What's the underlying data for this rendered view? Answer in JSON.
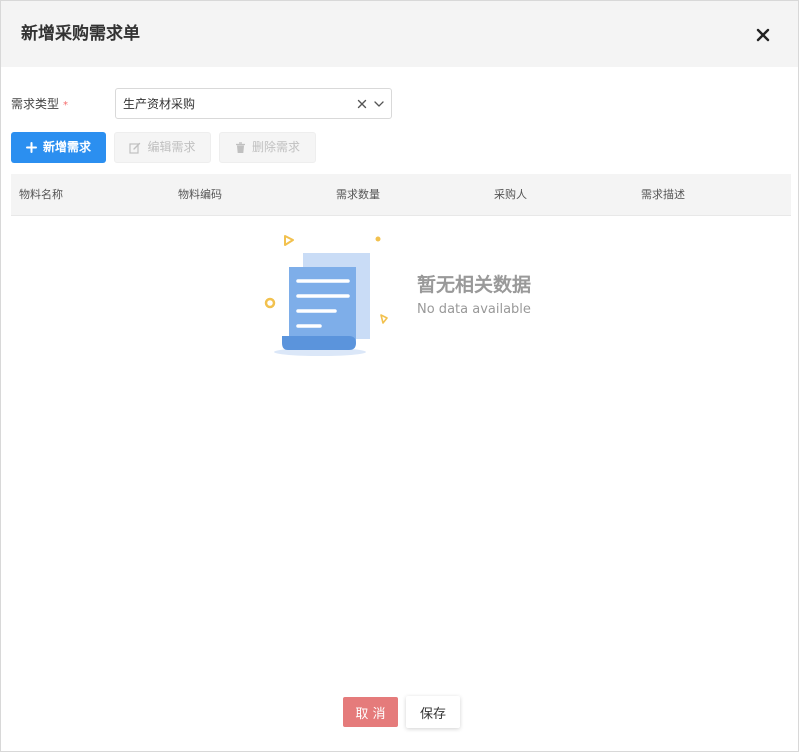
{
  "dialog": {
    "title": "新增采购需求单",
    "close_icon": "close-icon"
  },
  "form": {
    "demand_type_label": "需求类型",
    "required_mark": "*",
    "demand_type_value": "生产资材采购"
  },
  "toolbar": {
    "add_label": "新增需求",
    "edit_label": "编辑需求",
    "delete_label": "删除需求"
  },
  "table": {
    "columns": [
      "物料名称",
      "物料编码",
      "需求数量",
      "采购人",
      "需求描述"
    ]
  },
  "empty": {
    "title": "暂无相关数据",
    "subtitle": "No data available"
  },
  "footer": {
    "cancel_label": "取 消",
    "save_label": "保存"
  },
  "colors": {
    "primary": "#2b8ff0",
    "cancel": "#e57b7b",
    "required": "#f56c6c"
  }
}
